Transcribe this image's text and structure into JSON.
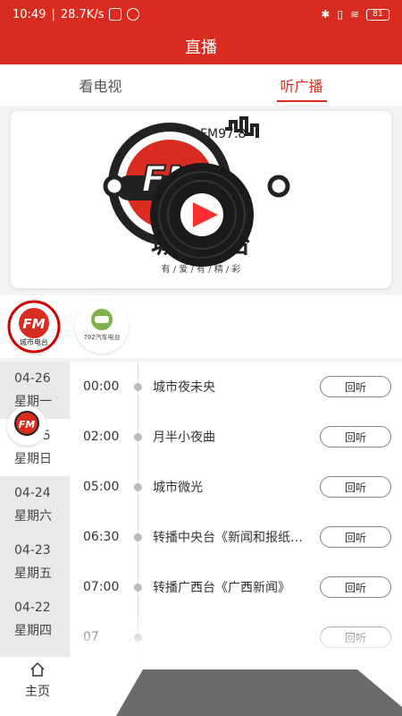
{
  "status_bar": {
    "time": "10:49",
    "speed": "28.7K/s",
    "battery": "81"
  },
  "header": {
    "title": "直播"
  },
  "tabs": [
    {
      "label": "看电视",
      "active": false
    },
    {
      "label": "听广播",
      "active": true
    }
  ],
  "banner": {
    "logo_text": "城市电台",
    "freq_text": "FM97.8",
    "slogan": "有 / 爱 / 有 / 精 / 彩"
  },
  "stations": [
    {
      "name": "城市电台"
    },
    {
      "name": "792汽车电台"
    }
  ],
  "dates": [
    {
      "date": "04-26",
      "weekday": "星期一",
      "active": false
    },
    {
      "date": "04-25",
      "weekday": "星期日",
      "active": true
    },
    {
      "date": "04-24",
      "weekday": "星期六",
      "active": false
    },
    {
      "date": "04-23",
      "weekday": "星期五",
      "active": false
    },
    {
      "date": "04-22",
      "weekday": "星期四",
      "active": false
    }
  ],
  "programs": [
    {
      "time": "00:00",
      "title": "城市夜未央",
      "button": "回听"
    },
    {
      "time": "02:00",
      "title": "月半小夜曲",
      "button": "回听"
    },
    {
      "time": "05:00",
      "title": "城市微光",
      "button": "回听"
    },
    {
      "time": "06:30",
      "title": "转播中央台《新闻和报纸摘要》",
      "button": "回听"
    },
    {
      "time": "07:00",
      "title": "转播广西台《广西新闻》",
      "button": "回听"
    },
    {
      "time": "07",
      "title": "",
      "button": "回听"
    }
  ],
  "bottom_nav": {
    "home_label": "主页"
  },
  "colors": {
    "accent": "#d92b1f",
    "play": "#ff2d2d"
  }
}
